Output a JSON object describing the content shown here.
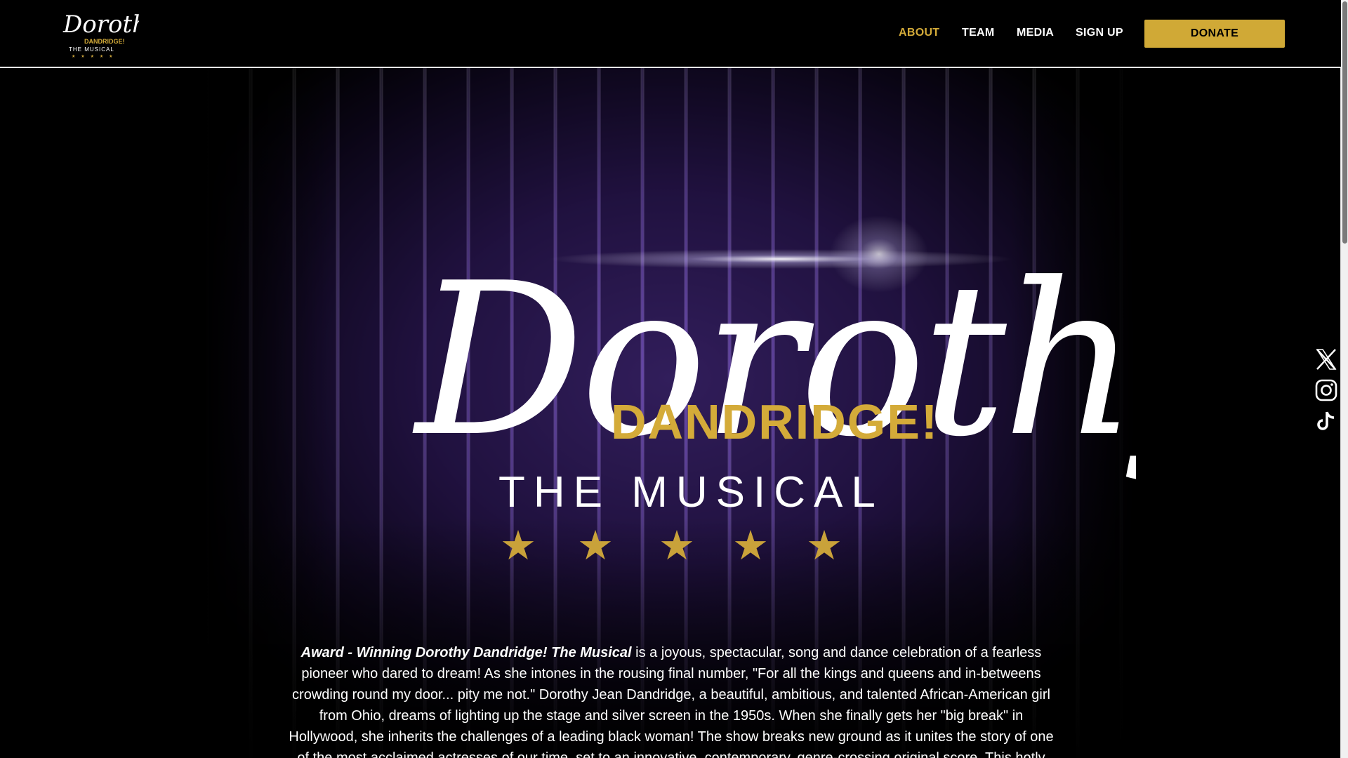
{
  "header": {
    "logo": {
      "script": "Dorothy",
      "sub": "DANDRIDGE!",
      "tag": "THE MUSICAL",
      "stars": "★ ★ ★ ★ ★"
    },
    "nav": [
      {
        "label": "ABOUT",
        "active": true
      },
      {
        "label": "TEAM",
        "active": false
      },
      {
        "label": "MEDIA",
        "active": false
      },
      {
        "label": "SIGN UP",
        "active": false
      }
    ],
    "donate_label": "DONATE"
  },
  "hero": {
    "title_script": "Dorothy",
    "title_sub": "DANDRIDGE!",
    "title_tag": "THE MUSICAL",
    "stars": [
      "★",
      "★",
      "★",
      "★",
      "★"
    ]
  },
  "copy": {
    "lead": "Award - Winning Dorothy Dandridge! The Musical",
    "body": " is a joyous, spectacular, song and dance celebration of a fearless pioneer who dared to dream! As she intones in the rousing final number, \"For all the kings and queens and in-betweens crowding round my door... pity me not.\" Dorothy Jean Dandridge, a beautiful, ambitious, and talented African-American girl from Ohio, dreams of lighting up the stage and silver screen in the 1950s. When she finally gets her \"big break\" in Hollywood, she inherits the challenges of a leading black woman! The show breaks new ground as it unites the story of one of the most acclaimed actresses of our time, set to an innovative, contemporary, genre-crossing original score. This hotly"
  },
  "social": [
    {
      "icon": "x-twitter-icon"
    },
    {
      "icon": "instagram-icon"
    },
    {
      "icon": "tiktok-icon"
    }
  ],
  "colors": {
    "gold": "#d4ab39",
    "curtain": "#3b2370",
    "background": "#000000"
  }
}
